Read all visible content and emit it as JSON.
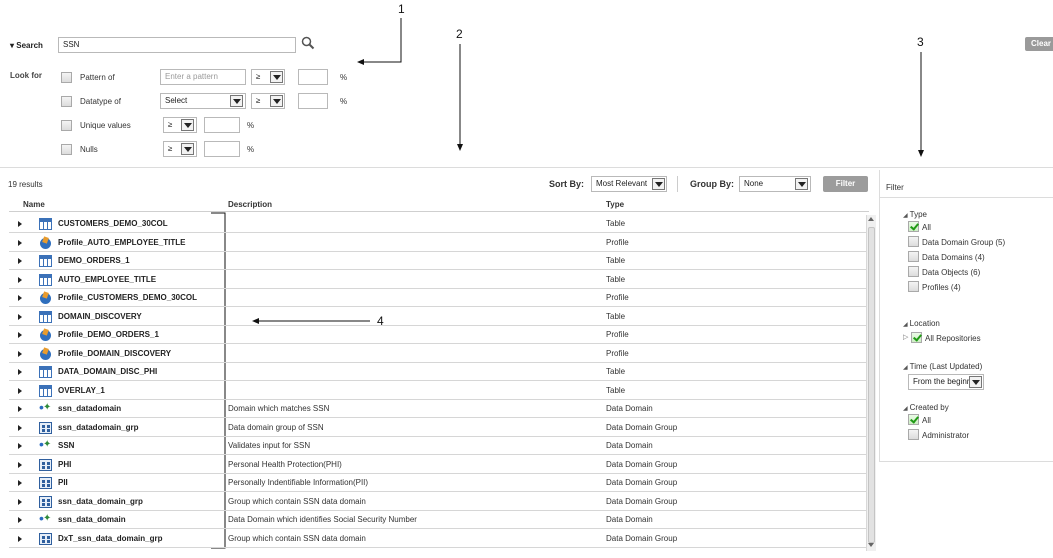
{
  "callouts": [
    "1",
    "2",
    "3",
    "4"
  ],
  "search": {
    "label": "Search",
    "value": "SSN",
    "clear_label": "Clear"
  },
  "look_for": {
    "label": "Look for",
    "pattern_label": "Pattern of",
    "pattern_placeholder": "Enter a pattern",
    "datatype_label": "Datatype of",
    "datatype_value": "Select",
    "unique_label": "Unique values",
    "nulls_label": "Nulls",
    "operator": "≥",
    "percent": "%"
  },
  "results": {
    "count_label": "19 results",
    "sort_by_label": "Sort By:",
    "sort_by_value": "Most Relevant",
    "group_by_label": "Group By:",
    "group_by_value": "None",
    "filter_button": "Filter",
    "columns": {
      "name": "Name",
      "description": "Description",
      "type": "Type"
    },
    "rows": [
      {
        "icon": "table-icon",
        "name": "CUSTOMERS_DEMO_30COL",
        "description": "",
        "type": "Table"
      },
      {
        "icon": "profile-icon",
        "name": "Profile_AUTO_EMPLOYEE_TITLE",
        "description": "",
        "type": "Profile"
      },
      {
        "icon": "table-icon",
        "name": "DEMO_ORDERS_1",
        "description": "",
        "type": "Table"
      },
      {
        "icon": "table-icon",
        "name": "AUTO_EMPLOYEE_TITLE",
        "description": "",
        "type": "Table"
      },
      {
        "icon": "profile-icon",
        "name": "Profile_CUSTOMERS_DEMO_30COL",
        "description": "",
        "type": "Profile"
      },
      {
        "icon": "table-icon",
        "name": "DOMAIN_DISCOVERY",
        "description": "",
        "type": "Table"
      },
      {
        "icon": "profile-icon",
        "name": "Profile_DEMO_ORDERS_1",
        "description": "",
        "type": "Profile"
      },
      {
        "icon": "profile-icon",
        "name": "Profile_DOMAIN_DISCOVERY",
        "description": "",
        "type": "Profile"
      },
      {
        "icon": "table-icon",
        "name": "DATA_DOMAIN_DISC_PHI",
        "description": "",
        "type": "Table"
      },
      {
        "icon": "table-icon",
        "name": "OVERLAY_1",
        "description": "",
        "type": "Table"
      },
      {
        "icon": "data-domain-icon",
        "name": "ssn_datadomain",
        "description": "Domain which matches SSN",
        "type": "Data Domain"
      },
      {
        "icon": "data-domain-group-icon",
        "name": "ssn_datadomain_grp",
        "description": "Data domain group of SSN",
        "type": "Data Domain Group"
      },
      {
        "icon": "data-domain-icon",
        "name": "SSN",
        "description": "Validates input for SSN",
        "type": "Data Domain"
      },
      {
        "icon": "data-domain-group-icon",
        "name": "PHI",
        "description": "Personal Health Protection(PHI)",
        "type": "Data Domain Group"
      },
      {
        "icon": "data-domain-group-icon",
        "name": "PII",
        "description": "Personally Indentifiable Information(PII)",
        "type": "Data Domain Group"
      },
      {
        "icon": "data-domain-group-icon",
        "name": "ssn_data_domain_grp",
        "description": "Group which contain SSN data domain",
        "type": "Data Domain Group"
      },
      {
        "icon": "data-domain-icon",
        "name": "ssn_data_domain",
        "description": "Data Domain which identifies Social Security Number",
        "type": "Data Domain"
      },
      {
        "icon": "data-domain-group-icon",
        "name": "DxT_ssn_data_domain_grp",
        "description": "Group which contain SSN data domain",
        "type": "Data Domain Group"
      }
    ]
  },
  "filter_panel": {
    "title": "Filter",
    "type": {
      "title": "Type",
      "items": [
        {
          "label": "All",
          "checked": true
        },
        {
          "label": "Data Domain Group (5)",
          "checked": false
        },
        {
          "label": "Data Domains (4)",
          "checked": false
        },
        {
          "label": "Data Objects (6)",
          "checked": false
        },
        {
          "label": "Profiles (4)",
          "checked": false
        }
      ]
    },
    "location": {
      "title": "Location",
      "item": "All Repositories"
    },
    "time": {
      "title": "Time (Last Updated)",
      "value": "From the beginning"
    },
    "created_by": {
      "title": "Created by",
      "items": [
        {
          "label": "All",
          "checked": true
        },
        {
          "label": "Administrator",
          "checked": false
        }
      ]
    }
  }
}
